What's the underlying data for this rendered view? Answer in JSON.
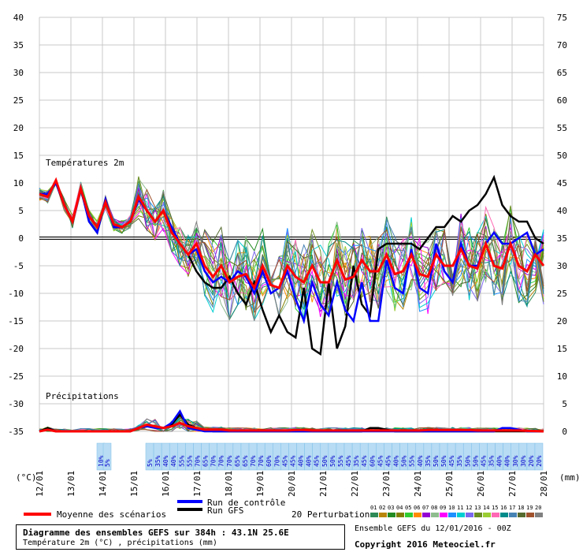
{
  "chart_data": {
    "type": "line",
    "title": "Diagramme des ensembles GEFS sur 384h : 43.1N 25.6E",
    "subtitle": "Température 2m (°C) , précipitations (mm)",
    "temp_label": "Températures 2m",
    "precip_label": "Précipitations",
    "left_unit": "(°C)",
    "right_unit": "(mm)",
    "y_left_ticks": [
      "40",
      "35",
      "30",
      "25",
      "20",
      "15",
      "10",
      "5",
      "0",
      "-5",
      "-10",
      "-15",
      "-20",
      "-25",
      "-30",
      "-35"
    ],
    "y_right_ticks": [
      "75",
      "70",
      "65",
      "60",
      "55",
      "50",
      "45",
      "40",
      "35",
      "30",
      "25",
      "20",
      "15",
      "10",
      "5",
      "0"
    ],
    "x_labels": [
      "12/01",
      "13/01",
      "14/01",
      "15/01",
      "16/01",
      "17/01",
      "18/01",
      "19/01",
      "20/01",
      "21/01",
      "22/01",
      "23/01",
      "24/01",
      "25/01",
      "26/01",
      "27/01",
      "28/01"
    ],
    "ylim_temp": [
      -35,
      40
    ],
    "ylim_precip": [
      0,
      75
    ],
    "grid": true,
    "prob_labels": [
      "10%",
      "5%",
      "5%",
      "35%",
      "40%",
      "40%",
      "55%",
      "55%",
      "70%",
      "65%",
      "70%",
      "70%",
      "70%",
      "65%",
      "65%",
      "70%",
      "70%",
      "60%",
      "70%",
      "45%",
      "45%",
      "40%",
      "40%",
      "45%",
      "50%",
      "50%",
      "55%",
      "45%",
      "35%",
      "45%",
      "60%",
      "45%",
      "45%",
      "40%",
      "50%",
      "55%",
      "40%",
      "35%",
      "50%",
      "50%",
      "45%",
      "35%",
      "50%",
      "50%",
      "45%",
      "35%",
      "40%",
      "40%",
      "30%",
      "30%",
      "20%",
      "20%"
    ],
    "series_mean": {
      "name": "Moyenne des scénarios",
      "color": "#ff0000",
      "temp": [
        8,
        7.5,
        10.5,
        6,
        3,
        9,
        4,
        2,
        6.5,
        2.5,
        2,
        3,
        7.5,
        5,
        3,
        5,
        1,
        -1,
        -3,
        -1,
        -5,
        -7,
        -5,
        -8,
        -7,
        -6.5,
        -9,
        -5,
        -8.5,
        -9,
        -5,
        -7,
        -8,
        -5,
        -8,
        -8,
        -4,
        -7.5,
        -7,
        -4,
        -6,
        -6,
        -3,
        -6.5,
        -6,
        -3,
        -6.5,
        -7,
        -3,
        -5,
        -5,
        -2,
        -5,
        -5.5,
        -1,
        -5,
        -5.5,
        -1,
        -5,
        -6,
        -3,
        -5
      ],
      "precip": [
        0,
        1,
        0,
        0,
        0,
        0,
        0,
        0,
        0,
        0,
        0,
        0,
        2,
        4,
        3,
        2,
        3,
        5,
        3,
        2,
        1,
        1,
        1,
        0.5,
        0.5,
        0.5,
        0.5,
        0.5,
        0.5,
        0.5,
        0.5,
        0.8,
        0.8,
        0.5,
        0.5,
        0.5,
        0.5,
        0.5,
        0.5,
        0.5,
        0.5,
        0.5,
        0.5,
        0.5,
        0.5,
        0.5,
        0.5,
        0.8,
        0.8,
        0.8,
        0.8,
        0.8,
        0.8,
        0.5,
        0.5,
        0.5,
        0.5,
        0.5,
        0.5,
        0.3,
        0.2,
        0
      ]
    },
    "series_control": {
      "name": "Run de contrôle",
      "color": "#0000ff",
      "temp": [
        8,
        8,
        10,
        6,
        3,
        9,
        3,
        1,
        7,
        2,
        2,
        3,
        7,
        5,
        3,
        5,
        2,
        -1,
        -3,
        -2,
        -6,
        -8,
        -7,
        -8,
        -6,
        -7,
        -10,
        -6,
        -10,
        -9,
        -6,
        -11,
        -15,
        -8,
        -12,
        -14,
        -8,
        -13,
        -15,
        -8,
        -15,
        -15,
        -4,
        -9,
        -10,
        -2,
        -9,
        -10,
        -1,
        -6,
        -8,
        -1,
        -5,
        -5,
        -1,
        1,
        -1,
        -1,
        0,
        1,
        -3,
        -2
      ],
      "precip": [
        0,
        1,
        0,
        0,
        0,
        0,
        0,
        0,
        0,
        0,
        0,
        0,
        2,
        3,
        2,
        2,
        5,
        12,
        2,
        1,
        0,
        0,
        0,
        0,
        0,
        0,
        0,
        0,
        0,
        0,
        0,
        0,
        0,
        0,
        0,
        0,
        0,
        0,
        0,
        0,
        0,
        0,
        0,
        0,
        0,
        0,
        0,
        0,
        0,
        0,
        0,
        0,
        0,
        0,
        0,
        0,
        2,
        2,
        1,
        0,
        0,
        0
      ]
    },
    "series_gfs": {
      "name": "Run GFS",
      "color": "#000000",
      "temp": [
        8,
        8,
        10,
        6,
        3,
        9,
        3,
        1,
        7,
        2,
        2,
        3,
        7,
        5,
        3,
        5,
        2,
        -1,
        -3,
        -6,
        -8,
        -9,
        -9,
        -7,
        -10,
        -12,
        -8,
        -13,
        -17,
        -14,
        -17,
        -18,
        -9,
        -20,
        -21,
        -8,
        -20,
        -16,
        -5,
        -12,
        -14,
        -2,
        -1,
        -1,
        -1,
        -1,
        -2,
        0,
        2,
        2,
        4,
        3,
        5,
        6,
        8,
        11,
        6,
        4,
        3,
        3,
        0,
        -1
      ],
      "precip": [
        0,
        2,
        0,
        0,
        0,
        0,
        0,
        0,
        0,
        0,
        0,
        0,
        2,
        4,
        3,
        2,
        4,
        10,
        4,
        2,
        1,
        0,
        0,
        0,
        0,
        0,
        0,
        0,
        0,
        0,
        0,
        0,
        0,
        0,
        0,
        0,
        0,
        0,
        0,
        0,
        2,
        2,
        1,
        0,
        0,
        0,
        0,
        0,
        0,
        0,
        0,
        0,
        0,
        0,
        0,
        0,
        0,
        0,
        0,
        0,
        0,
        0
      ]
    },
    "perturbations_legend": {
      "label": "20 Perturbations",
      "ids": [
        "01",
        "02",
        "03",
        "04",
        "05",
        "06",
        "07",
        "08",
        "09",
        "10",
        "11",
        "12",
        "13",
        "14",
        "15",
        "16",
        "17",
        "18",
        "19",
        "20"
      ],
      "colors": [
        "#2e8b57",
        "#b8860b",
        "#228b22",
        "#808000",
        "#32cd32",
        "#ff8c00",
        "#9400d3",
        "#8fbc8f",
        "#ff00ff",
        "#1e90ff",
        "#00ced1",
        "#7b68ee",
        "#6b8e23",
        "#9acd32",
        "#ff69b4",
        "#008b8b",
        "#4682b4",
        "#556b2f",
        "#a0522d",
        "#808080"
      ]
    }
  },
  "legend": {
    "mean_label": "Moyenne des scénarios",
    "control_label": "Run de contrôle",
    "gfs_label": "Run GFS"
  },
  "footer": {
    "ensemble_label": "Ensemble GEFS du 12/01/2016 - 00Z",
    "copyright": "Copyright 2016 Meteociel.fr"
  }
}
